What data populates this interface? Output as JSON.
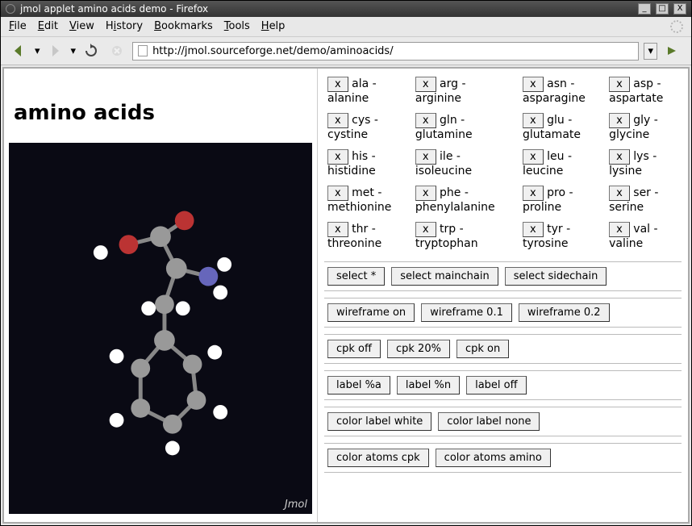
{
  "window": {
    "title": "jmol applet amino acids demo - Firefox"
  },
  "window_controls": {
    "min": "_",
    "max": "□",
    "close": "X"
  },
  "menubar": [
    {
      "key": "F",
      "rest": "ile"
    },
    {
      "key": "E",
      "rest": "dit"
    },
    {
      "key": "V",
      "rest": "iew"
    },
    {
      "key": "H",
      "rest": "istory",
      "pre": ""
    },
    {
      "key": "B",
      "rest": "ookmarks"
    },
    {
      "key": "T",
      "rest": "ools"
    },
    {
      "key": "H",
      "rest": "elp"
    }
  ],
  "url": "http://jmol.sourceforge.net/demo/aminoacids/",
  "heading": "amino acids",
  "viewer_watermark": "Jmol",
  "amino_acids": [
    [
      {
        "abbr": "ala",
        "name": "alanine"
      },
      {
        "abbr": "arg",
        "name": "arginine"
      },
      {
        "abbr": "asn",
        "name": "asparagine"
      },
      {
        "abbr": "asp",
        "name": "aspartate"
      }
    ],
    [
      {
        "abbr": "cys",
        "name": "cystine"
      },
      {
        "abbr": "gln",
        "name": "glutamine"
      },
      {
        "abbr": "glu",
        "name": "glutamate"
      },
      {
        "abbr": "gly",
        "name": "glycine"
      }
    ],
    [
      {
        "abbr": "his",
        "name": "histidine"
      },
      {
        "abbr": "ile",
        "name": "isoleucine"
      },
      {
        "abbr": "leu",
        "name": "leucine"
      },
      {
        "abbr": "lys",
        "name": "lysine"
      }
    ],
    [
      {
        "abbr": "met",
        "name": "methionine"
      },
      {
        "abbr": "phe",
        "name": "phenylalanine"
      },
      {
        "abbr": "pro",
        "name": "proline"
      },
      {
        "abbr": "ser",
        "name": "serine"
      }
    ],
    [
      {
        "abbr": "thr",
        "name": "threonine"
      },
      {
        "abbr": "trp",
        "name": "tryptophan"
      },
      {
        "abbr": "tyr",
        "name": "tyrosine"
      },
      {
        "abbr": "val",
        "name": "valine"
      }
    ]
  ],
  "x_label": "x",
  "groups": [
    [
      "select *",
      "select mainchain",
      "select sidechain"
    ],
    [
      "wireframe on",
      "wireframe 0.1",
      "wireframe 0.2"
    ],
    [
      "cpk off",
      "cpk 20%",
      "cpk on"
    ],
    [
      "label %a",
      "label %n",
      "label off"
    ],
    [
      "color label white",
      "color label none"
    ],
    [
      "color atoms cpk",
      "color atoms amino"
    ]
  ]
}
